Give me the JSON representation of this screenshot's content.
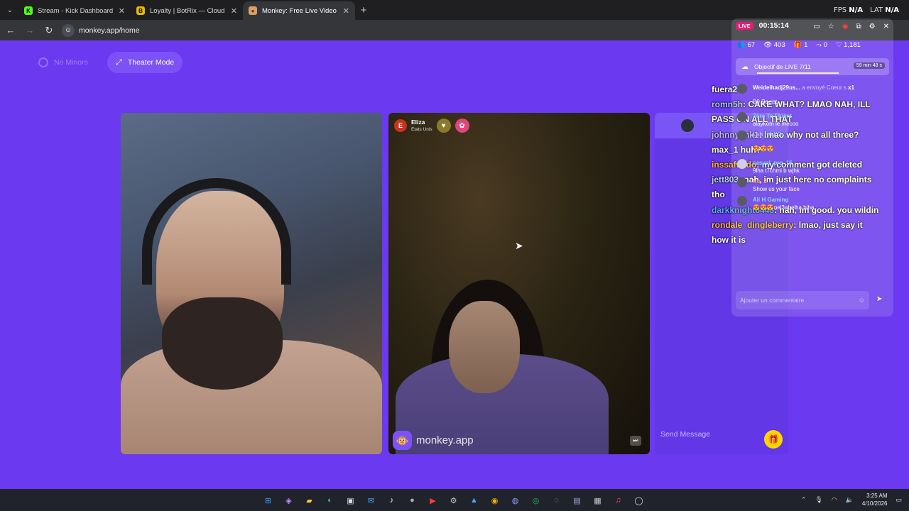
{
  "browser": {
    "tabs": [
      {
        "title": "Stream - Kick Dashboard",
        "icon": "kick-icon",
        "color": "#53fc18",
        "active": false
      },
      {
        "title": "Loyalty | BotRix — Cloud Stream",
        "icon": "botrix-icon",
        "color": "#e6b800",
        "active": false
      },
      {
        "title": "Monkey: Free Live Video Ch",
        "icon": "monkey-icon",
        "color": "#d9a066",
        "active": true
      }
    ],
    "url": "monkey.app/home",
    "fps_label": "FPS",
    "fps_value": "N/A",
    "lat_label": "LAT",
    "lat_value": "N/A"
  },
  "page": {
    "no_minors_label": "No Minors",
    "theater_mode_label": "Theater Mode",
    "peer": {
      "avatar_letter": "E",
      "name": "Eliza",
      "country": "États Unis"
    },
    "brand_text": "monkey.app",
    "side_panel": {
      "send_placeholder": "Send Message"
    }
  },
  "overlay_chat": [
    {
      "user": "fuera2",
      "user_color": "#ffffff",
      "text": ""
    },
    {
      "user": "romn5h",
      "user_color": "#a8c7ff",
      "text": ": CAKE WHAT? LMAO NAH, ILL PASS ON ALL THAT"
    },
    {
      "user": "johnnylmk1",
      "user_color": "#c7b6ff",
      "text": ": lmao why not all three?"
    },
    {
      "user": "max_1",
      "user_color": "#ffffff",
      "text": "huh?"
    },
    {
      "user": "inssafwrdo",
      "user_color": "#ffb347",
      "text": ": my comment got deleted"
    },
    {
      "user": "jett803",
      "user_color": "#b8d3ff",
      "text": ": nah, im just here no complaints tho"
    },
    {
      "user": "darkknight6443",
      "user_color": "#5aa9ff",
      "text": ": nah, im good. you wildin"
    },
    {
      "user": "rondale_dingleberry",
      "user_color": "#ffb347",
      "text": ": lmao, just say it how it is"
    }
  ],
  "extension": {
    "live_label": "LIVE",
    "timer": "00:15:14",
    "stats": {
      "followers": "67",
      "viewers": "403",
      "gifts": "1",
      "subs": "0",
      "likes": "1,181"
    },
    "goal_text": "Objectif de LIVE 7/11",
    "goal_time": "59 min 48 s",
    "goal_progress": 0.64,
    "chat": [
      {
        "user": "Weidelhadj29us...",
        "text": "a envoyé Coeur s",
        "extra": "x1"
      },
      {
        "user": "",
        "text": "B9 Racist"
      },
      {
        "user": "Zero To Fluent",
        "text": "alaykom le mecoo"
      },
      {
        "user": "Lah",
        "text": "HA KO"
      },
      {
        "user": "",
        "text": "😍😍😍"
      },
      {
        "user": "casual_pro_16",
        "text": "9lha t7chmi b wjhk"
      },
      {
        "user": "No. 2",
        "text": "Show us your face"
      },
      {
        "user": "Ali H Gaming",
        "text": "😍😍😍nel3abelha biha"
      }
    ],
    "comment_placeholder": "Ajouter un commentaire"
  },
  "taskbar": {
    "time": "3:25 AM",
    "date": "4/10/2026",
    "apps": [
      "windows-icon",
      "copilot-icon",
      "explorer-icon",
      "edge-icon",
      "store-icon",
      "mail-icon",
      "tiktok-icon",
      "teams-icon",
      "youtube-icon",
      "settings-icon",
      "photos-icon",
      "chrome-icon",
      "discord-icon",
      "spotify-icon",
      "messenger-icon",
      "notepad-icon",
      "calculator-icon",
      "tiktok-studio-icon",
      "obs-icon"
    ]
  }
}
